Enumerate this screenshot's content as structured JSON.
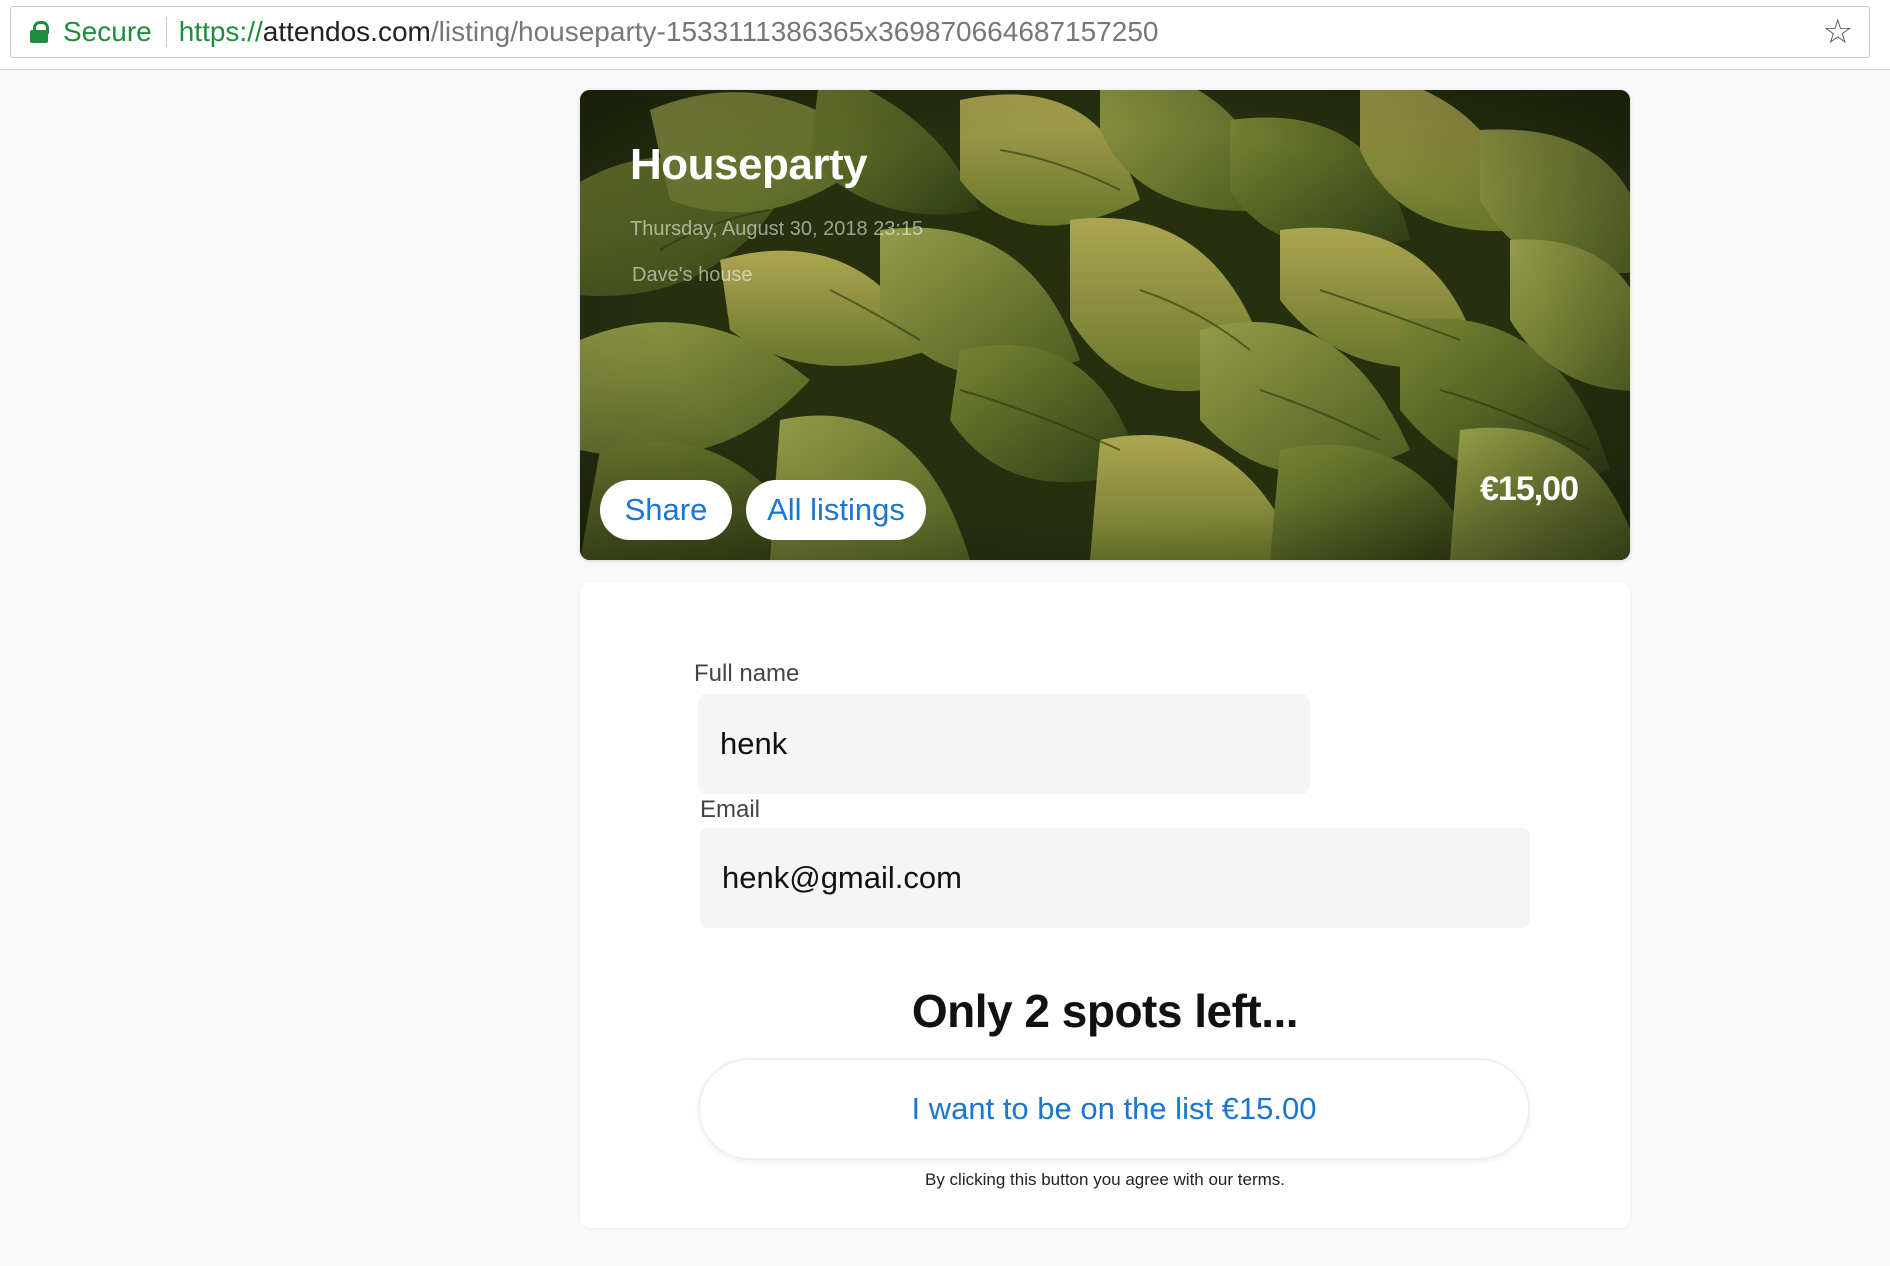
{
  "browser": {
    "secure_label": "Secure",
    "url_scheme": "https://",
    "url_host": "attendos.com",
    "url_path": "/listing/houseparty-1533111386365x369870664687157250",
    "bookmark_icon": "star-icon",
    "lock_icon": "lock-icon"
  },
  "event": {
    "title": "Houseparty",
    "datetime": "Thursday, August 30, 2018 23:15",
    "venue": "Dave's house",
    "price": "€15,00",
    "share_label": "Share",
    "all_listings_label": "All listings"
  },
  "form": {
    "name_label": "Full name",
    "name_value": "henk",
    "email_label": "Email",
    "email_value": "henk@gmail.com",
    "spots_text": "Only 2 spots left...",
    "cta_label": "I want to be on the list €15.00",
    "terms_text": "By clicking this button you agree with our terms."
  },
  "colors": {
    "secure_green": "#1e8e3e",
    "link_blue": "#1976d2",
    "input_bg": "#f4f5f4",
    "page_bg": "#f9f9f9"
  }
}
